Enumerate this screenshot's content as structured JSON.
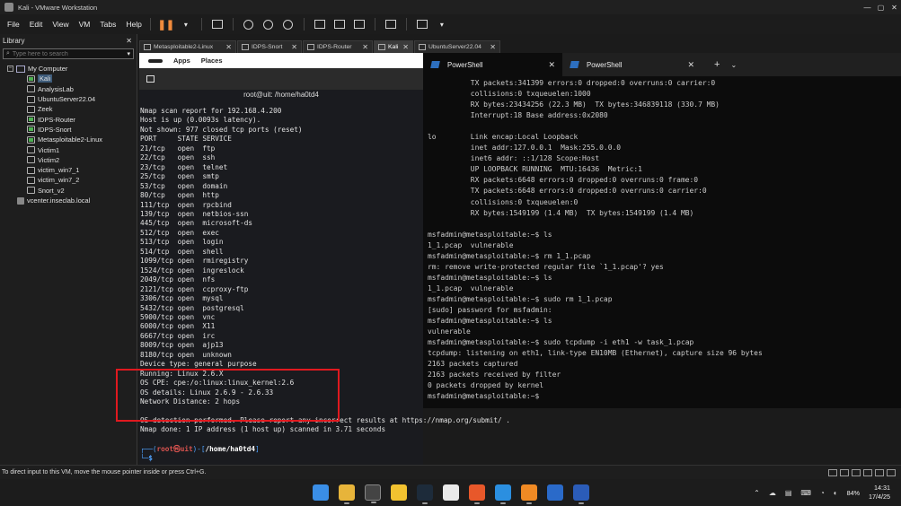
{
  "window": {
    "title": "Kali - VMware Workstation",
    "controls": [
      "—",
      "▢",
      "✕"
    ]
  },
  "menubar": {
    "items": [
      "File",
      "Edit",
      "View",
      "VM",
      "Tabs",
      "Help"
    ]
  },
  "library": {
    "title": "Library",
    "search_placeholder": "Type here to search",
    "root": "My Computer",
    "vms": [
      "Kali",
      "AnalysisLab",
      "UbuntuServer22.04",
      "Zeek",
      "IDPS-Router",
      "IDPS-Snort",
      "Metasploitable2-Linux",
      "Victim1",
      "Victim2",
      "victim_win7_1",
      "victim_win7_2",
      "Snort_v2"
    ],
    "server": "vcenter.inseclab.local"
  },
  "vm_tabs": [
    "Metasploitable2-Linux",
    "IDPS-Snort",
    "IDPS-Router",
    "Kali",
    "UbuntuServer22.04"
  ],
  "kali": {
    "topbar": {
      "apps": "Apps",
      "places": "Places"
    },
    "terminal_title": "root@uit: /home/ha0td4",
    "lines": [
      "Nmap scan report for 192.168.4.200",
      "Host is up (0.0093s latency).",
      "Not shown: 977 closed tcp ports (reset)",
      "PORT     STATE SERVICE",
      "21/tcp   open  ftp",
      "22/tcp   open  ssh",
      "23/tcp   open  telnet",
      "25/tcp   open  smtp",
      "53/tcp   open  domain",
      "80/tcp   open  http",
      "111/tcp  open  rpcbind",
      "139/tcp  open  netbios-ssn",
      "445/tcp  open  microsoft-ds",
      "512/tcp  open  exec",
      "513/tcp  open  login",
      "514/tcp  open  shell",
      "1099/tcp open  rmiregistry",
      "1524/tcp open  ingreslock",
      "2049/tcp open  nfs",
      "2121/tcp open  ccproxy-ftp",
      "3306/tcp open  mysql",
      "5432/tcp open  postgresql",
      "5900/tcp open  vnc",
      "6000/tcp open  X11",
      "6667/tcp open  irc",
      "8009/tcp open  ajp13",
      "8180/tcp open  unknown",
      "Device type: general purpose",
      "Running: Linux 2.6.X",
      "OS CPE: cpe:/o:linux:linux_kernel:2.6",
      "OS details: Linux 2.6.9 - 2.6.33",
      "Network Distance: 2 hops",
      "",
      "OS detection performed. Please report any incorrect results at https://nmap.org/submit/ .",
      "Nmap done: 1 IP address (1 host up) scanned in 3.71 seconds"
    ],
    "prompt": {
      "user": "root",
      "host": "uit",
      "path": "/home/ha0td4"
    }
  },
  "powershell": {
    "tabs": [
      "PowerShell",
      "PowerShell"
    ],
    "lines": [
      "          TX packets:341399 errors:0 dropped:0 overruns:0 carrier:0",
      "          collisions:0 txqueuelen:1000",
      "          RX bytes:23434256 (22.3 MB)  TX bytes:346839118 (330.7 MB)",
      "          Interrupt:18 Base address:0x2080",
      "",
      "lo        Link encap:Local Loopback",
      "          inet addr:127.0.0.1  Mask:255.0.0.0",
      "          inet6 addr: ::1/128 Scope:Host",
      "          UP LOOPBACK RUNNING  MTU:16436  Metric:1",
      "          RX packets:6648 errors:0 dropped:0 overruns:0 frame:0",
      "          TX packets:6648 errors:0 dropped:0 overruns:0 carrier:0",
      "          collisions:0 txqueuelen:0",
      "          RX bytes:1549199 (1.4 MB)  TX bytes:1549199 (1.4 MB)",
      "",
      "msfadmin@metasploitable:~$ ls",
      "1_1.pcap  vulnerable",
      "msfadmin@metasploitable:~$ rm 1_1.pcap",
      "rm: remove write-protected regular file `1_1.pcap'? yes",
      "msfadmin@metasploitable:~$ ls",
      "1_1.pcap  vulnerable",
      "msfadmin@metasploitable:~$ sudo rm 1_1.pcap",
      "[sudo] password for msfadmin:",
      "msfadmin@metasploitable:~$ ls",
      "vulnerable",
      "msfadmin@metasploitable:~$ sudo tcpdump -i eth1 -w task_1.pcap",
      "tcpdump: listening on eth1, link-type EN10MB (Ethernet), capture size 96 bytes",
      "2163 packets captured",
      "2163 packets received by filter",
      "0 packets dropped by kernel",
      "msfadmin@metasploitable:~$"
    ]
  },
  "statusbar": {
    "message": "To direct input to this VM, move the mouse pointer inside or press Ctrl+G."
  },
  "taskbar": {
    "battery": "84%",
    "time": "14:31",
    "date": "17/4/25"
  }
}
